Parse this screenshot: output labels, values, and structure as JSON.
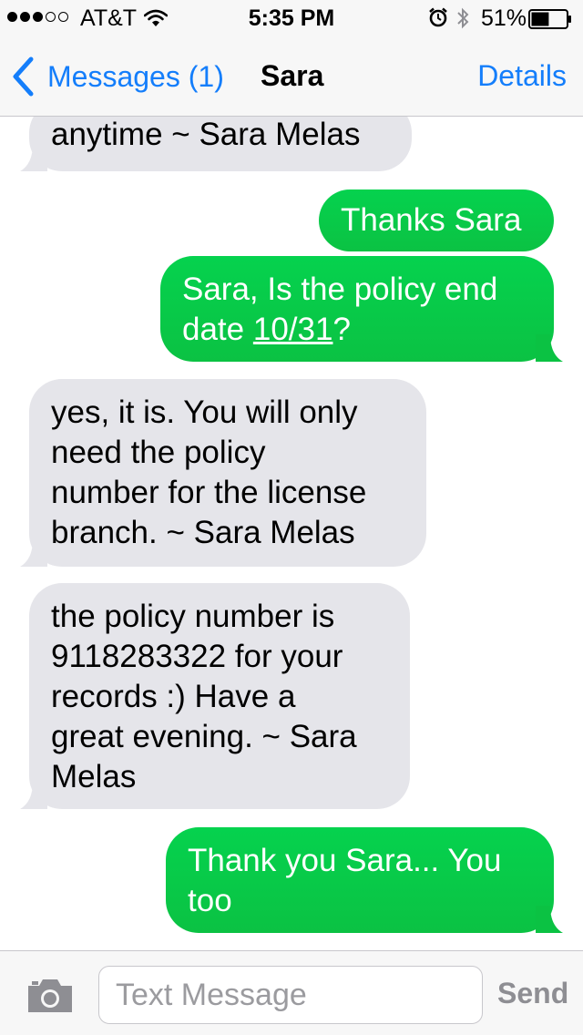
{
  "status_bar": {
    "signal_bars_filled": 3,
    "signal_bars_total": 5,
    "carrier": "AT&T",
    "time": "5:35 PM",
    "battery_percent": "51%",
    "battery_level": 0.51,
    "icons": [
      "wifi-icon",
      "alarm-icon",
      "bluetooth-icon",
      "battery-icon"
    ]
  },
  "nav": {
    "back_label": "Messages (1)",
    "title": "Sara",
    "details_label": "Details"
  },
  "messages": [
    {
      "direction": "incoming",
      "text": "anytime ~ Sara Melas"
    },
    {
      "direction": "outgoing",
      "text": "Thanks Sara"
    },
    {
      "direction": "outgoing",
      "text_before": "Sara, Is the policy end\ndate ",
      "link_text": "10/31",
      "text_after": "?"
    },
    {
      "direction": "incoming",
      "text": "yes, it is.  You will only\nneed the policy\nnumber for the license\nbranch. ~ Sara Melas"
    },
    {
      "direction": "incoming",
      "text": "the policy number is\n9118283322 for your\nrecords :)  Have a\ngreat evening. ~ Sara\nMelas"
    },
    {
      "direction": "outgoing",
      "text": "Thank you Sara... You\ntoo"
    }
  ],
  "composer": {
    "placeholder": "Text Message",
    "value": "",
    "send_label": "Send"
  },
  "colors": {
    "accent_blue": "#147efb",
    "outgoing_bubble": "#0bc243",
    "incoming_bubble": "#e5e5ea",
    "bar_background": "#f7f7f7"
  }
}
